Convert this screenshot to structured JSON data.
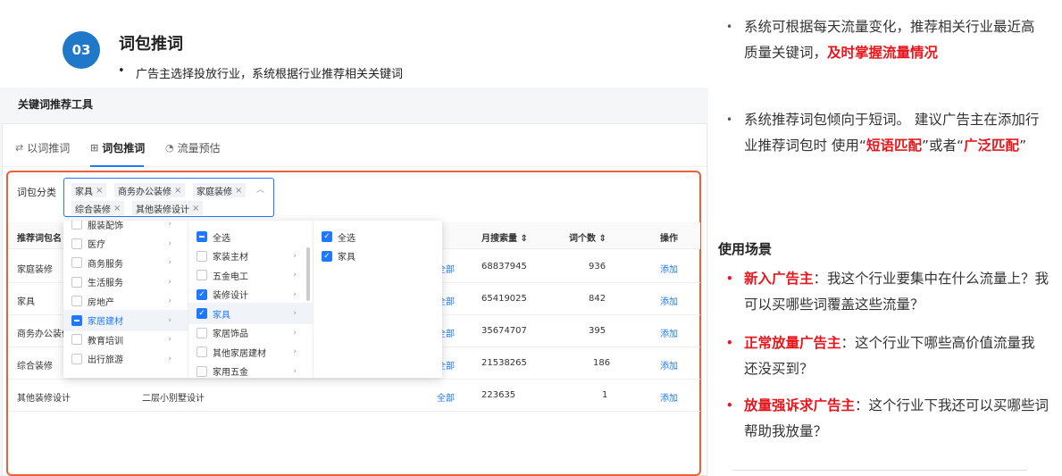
{
  "header": {
    "number": "03",
    "title": "词包推词",
    "bullet": "广告主选择投放行业，系统根据行业推荐相关关键词"
  },
  "tool": {
    "title": "关键词推荐工具",
    "tabs": [
      {
        "label": "以词推词",
        "icon": "link-icon"
      },
      {
        "label": "词包推词",
        "icon": "package-icon"
      },
      {
        "label": "流量预估",
        "icon": "gauge-icon"
      }
    ],
    "filter_label": "词包分类",
    "tags": [
      "家具",
      "商务办公装修",
      "家庭装修",
      "综合装修",
      "其他装修设计"
    ],
    "columns": [
      "推荐词包名",
      "月搜索量 ⇕",
      "词个数 ⇕",
      "操作"
    ],
    "rows": [
      {
        "name": "家庭装修",
        "mid": "",
        "scope": "全部",
        "volume": "68837945",
        "count": "936",
        "action": "添加"
      },
      {
        "name": "家具",
        "mid": "",
        "scope": "全部",
        "volume": "65419025",
        "count": "842",
        "action": "添加"
      },
      {
        "name": "商务办公装修",
        "mid": "",
        "scope": "全部",
        "volume": "35674707",
        "count": "395",
        "action": "添加"
      },
      {
        "name": "综合装修",
        "mid": "",
        "scope": "全部",
        "volume": "21538265",
        "count": "186",
        "action": "添加"
      },
      {
        "name": "其他装修设计",
        "mid": "二层小别墅设计",
        "scope": "全部",
        "volume": "223635",
        "count": "1",
        "action": "添加"
      }
    ],
    "cascade": {
      "col1": [
        {
          "label": "服装配饰",
          "state": "none"
        },
        {
          "label": "医疗",
          "state": "none"
        },
        {
          "label": "商务服务",
          "state": "none"
        },
        {
          "label": "生活服务",
          "state": "none"
        },
        {
          "label": "房地产",
          "state": "none"
        },
        {
          "label": "家居建材",
          "state": "indet",
          "selected": true
        },
        {
          "label": "教育培训",
          "state": "none"
        },
        {
          "label": "出行旅游",
          "state": "none"
        }
      ],
      "col2": [
        {
          "label": "全选",
          "state": "indet"
        },
        {
          "label": "家装主材",
          "state": "none"
        },
        {
          "label": "五金电工",
          "state": "none"
        },
        {
          "label": "装修设计",
          "state": "checked"
        },
        {
          "label": "家具",
          "state": "checked",
          "selected": true
        },
        {
          "label": "家居饰品",
          "state": "none"
        },
        {
          "label": "其他家居建材",
          "state": "none"
        },
        {
          "label": "家用五金",
          "state": "none"
        }
      ],
      "col3": [
        {
          "label": "全选",
          "state": "checked"
        },
        {
          "label": "家具",
          "state": "checked"
        }
      ]
    }
  },
  "notes": {
    "b1_plain": "系统可根据每天流量变化，推荐相关行业最近高质量关键词，",
    "b1_red": "及时掌握流量情况",
    "b2_plain1": "系统推荐词包倾向于短词。 建议广告主在添加行业推荐词包时    使用“",
    "b2_red1": "短语匹配",
    "b2_plain2": "”或者“",
    "b2_red2": "广泛匹配",
    "b2_plain3": "”",
    "scene_title": "使用场景",
    "scenes": [
      {
        "red": "新入广告主",
        "text": "：我这个行业要集中在什么流量上？我可以买哪些词覆盖这些流量？"
      },
      {
        "red": "正常放量广告主",
        "text": "：这个行业下哪些高价值流量我还没买到？"
      },
      {
        "red": "放量强诉求广告主",
        "text": "：这个行业下我还可以买哪些词帮助我放量？"
      }
    ]
  },
  "colors": {
    "accent": "#1f78ff",
    "highlight": "#e8613c",
    "emphasis": "#e8161c",
    "badge": "#1f78c8"
  }
}
